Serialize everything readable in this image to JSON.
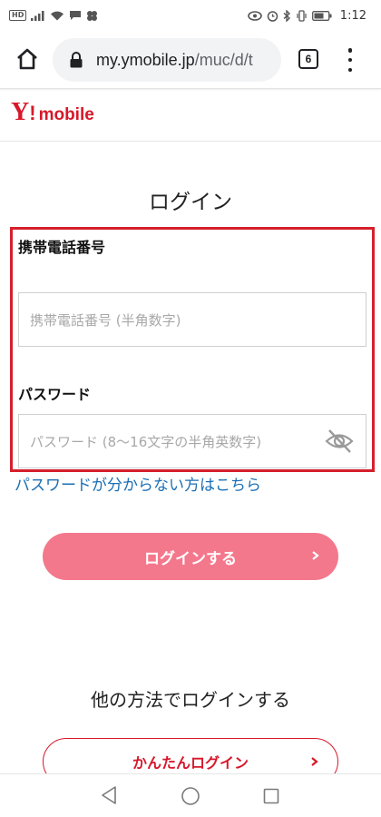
{
  "status_bar": {
    "hd_label": "HD",
    "time": "1:12"
  },
  "browser": {
    "url_host": "my.ymobile.jp",
    "url_path": "/muc/d/t",
    "tab_count": "6"
  },
  "site": {
    "logo_y": "Y",
    "logo_bang": "!",
    "logo_word": "mobile",
    "brand_color": "#d7182a"
  },
  "login": {
    "title": "ログイン",
    "phone_label": "携帯電話番号",
    "phone_placeholder": "携帯電話番号 (半角数字)",
    "phone_value": "",
    "password_label": "パスワード",
    "password_placeholder": "パスワード (8〜16文字の半角英数字)",
    "password_value": "",
    "forgot_link": "パスワードが分からない方はこちら",
    "submit_label": "ログインする",
    "submit_color": "#f4788c"
  },
  "other_login": {
    "title": "他の方法でログインする",
    "easy_login_label": "かんたんログイン"
  },
  "icons": {
    "home": "home-icon",
    "lock": "lock-icon",
    "menu": "more-vert-icon",
    "eye_off": "eye-off-icon",
    "chevron": "chevron-right-icon",
    "nav_back": "back-triangle-icon",
    "nav_home": "home-circle-icon",
    "nav_recent": "recent-square-icon"
  }
}
